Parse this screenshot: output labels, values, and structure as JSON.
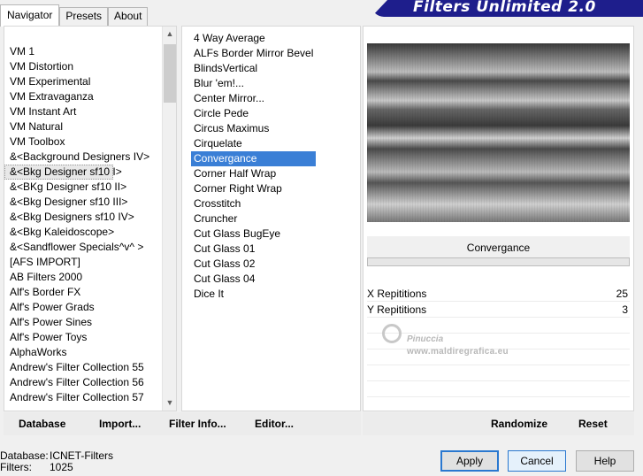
{
  "tabs": [
    "Navigator",
    "Presets",
    "About"
  ],
  "banner": "Filters Unlimited 2.0",
  "categories": [
    "VM 1",
    "VM Distortion",
    "VM Experimental",
    "VM Extravaganza",
    "VM Instant Art",
    "VM Natural",
    "VM Toolbox",
    "&<Background Designers IV>",
    "&<Bkg Designer sf10 I>",
    "&<BKg Designer sf10 II>",
    "&<Bkg Designer sf10 III>",
    "&<Bkg Designers sf10 IV>",
    "&<Bkg Kaleidoscope>",
    "&<Sandflower Specials^v^ >",
    "[AFS IMPORT]",
    "AB Filters 2000",
    "Alf's Border FX",
    "Alf's Power Grads",
    "Alf's Power Sines",
    "Alf's Power Toys",
    "AlphaWorks",
    "Andrew's Filter Collection 55",
    "Andrew's Filter Collection 56",
    "Andrew's Filter Collection 57"
  ],
  "filters": [
    "4 Way Average",
    "ALFs Border Mirror Bevel",
    "BlindsVertical",
    "Blur 'em!...",
    "Center Mirror...",
    "Circle Pede",
    "Circus Maximus",
    "Cirquelate",
    "Convergance",
    "Corner Half Wrap",
    "Corner Right Wrap",
    "Crosstitch",
    "Cruncher",
    "Cut Glass  BugEye",
    "Cut Glass 01",
    "Cut Glass 02",
    "Cut Glass 04",
    "Dice It"
  ],
  "selected_filter": "Convergance",
  "params": [
    {
      "label": "X Repititions",
      "value": "25"
    },
    {
      "label": "Y Repititions",
      "value": "3"
    }
  ],
  "watermark": {
    "name": "Pinuccia",
    "url": "www.maldiregrafica.eu"
  },
  "left_buttons": {
    "database": "Database",
    "import": "Import...",
    "filter_info": "Filter Info...",
    "editor": "Editor..."
  },
  "right_buttons": {
    "randomize": "Randomize",
    "reset": "Reset"
  },
  "status": {
    "database_label": "Database:",
    "database_value": "ICNET-Filters",
    "filters_label": "Filters:",
    "filters_value": "1025"
  },
  "dialog_buttons": {
    "apply": "Apply",
    "cancel": "Cancel",
    "help": "Help"
  },
  "colors": {
    "banner": "#1e1e8c",
    "selection": "#3a7fd6"
  }
}
